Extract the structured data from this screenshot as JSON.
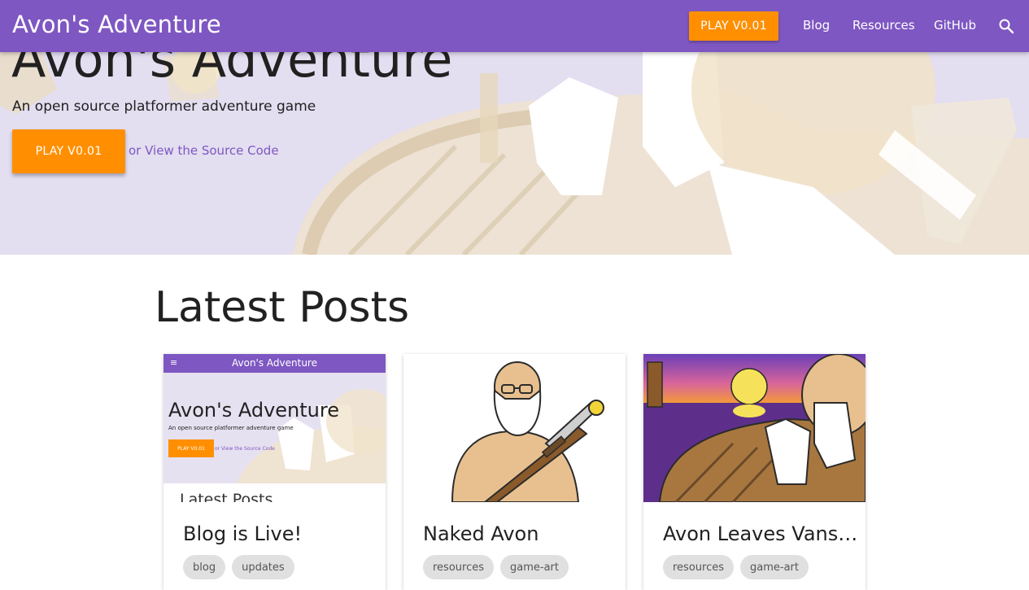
{
  "header": {
    "brand": "Avon's Adventure",
    "play_label": "PLAY V0.01",
    "nav": {
      "blog": "Blog",
      "resources": "Resources",
      "github": "GitHub"
    },
    "search_icon": "search-icon"
  },
  "hero": {
    "title": "Avon's Adventure",
    "subtitle": "An open source platformer adventure game",
    "play_label": "PLAY V0.01",
    "source_link": "or View the Source Code"
  },
  "latest": {
    "title": "Latest Posts",
    "posts": [
      {
        "title": "Blog is Live!",
        "tags": [
          "blog",
          "updates"
        ],
        "preview": {
          "bar_menu": "≡",
          "bar_brand": "Avon's Adventure",
          "title": "Avon's Adventure",
          "subtitle": "An open source platformer adventure game",
          "play_label": "PLAY V0.01",
          "source_link": "or View the Source Code",
          "latest": "Latest Posts"
        }
      },
      {
        "title": "Naked Avon",
        "tags": [
          "resources",
          "game-art"
        ]
      },
      {
        "title": "Avon Leaves Vans…",
        "tags": [
          "resources",
          "game-art"
        ]
      }
    ]
  },
  "colors": {
    "primary": "#7e57c2",
    "accent": "#ff8f00",
    "chip": "#e0e0e0"
  }
}
